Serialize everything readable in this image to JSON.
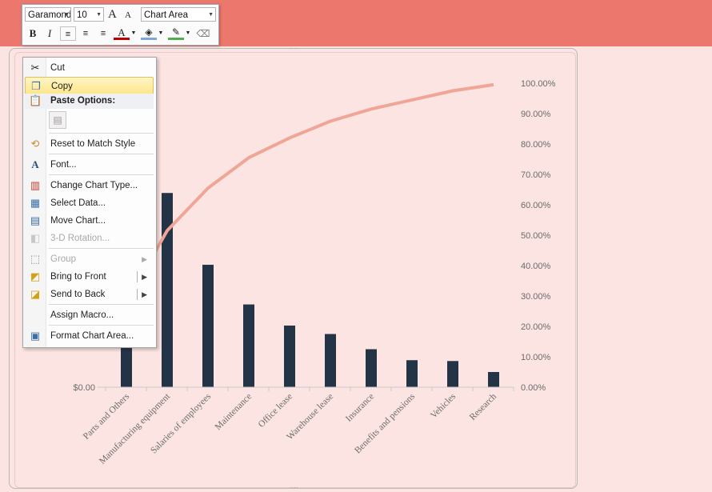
{
  "mini_toolbar": {
    "font_name": "Garamond",
    "font_size": "10",
    "element_selector": "Chart Area",
    "bold": "B",
    "italic": "I",
    "font_color_glyph": "A",
    "grow_font": "A",
    "shrink_font": "A"
  },
  "context_menu": {
    "items": [
      {
        "label": "Cut",
        "icon": "scissors-icon"
      },
      {
        "label": "Copy",
        "icon": "copy-icon"
      },
      {
        "label": "Paste Options:",
        "icon": "paste-icon"
      },
      {
        "label": "Reset to Match Style",
        "icon": "reset-style-icon"
      },
      {
        "label": "Font...",
        "icon": "font-icon"
      },
      {
        "label": "Change Chart Type...",
        "icon": "chart-type-icon"
      },
      {
        "label": "Select Data...",
        "icon": "select-data-icon"
      },
      {
        "label": "Move Chart...",
        "icon": "move-chart-icon"
      },
      {
        "label": "3-D Rotation...",
        "icon": "rotation-3d-icon"
      },
      {
        "label": "Group",
        "icon": "group-icon"
      },
      {
        "label": "Bring to Front",
        "icon": "bring-front-icon"
      },
      {
        "label": "Send to Back",
        "icon": "send-back-icon"
      },
      {
        "label": "Assign Macro...",
        "icon": ""
      },
      {
        "label": "Format Chart Area...",
        "icon": "format-chart-area-icon"
      }
    ]
  },
  "chart_data": {
    "type": "bar",
    "categories": [
      "Parts and Others",
      "Manufacturing equipment",
      "Salaries of employees",
      "Maintenance",
      "Office lease",
      "Warehouse lease",
      "Insurance",
      "Benefits and pensions",
      "Vehicles",
      "Research"
    ],
    "series": [
      {
        "values": [
          0.55,
          2.3,
          1.45,
          0.98,
          0.73,
          0.63,
          0.45,
          0.32,
          0.31,
          0.18
        ],
        "color": "#243447"
      },
      {
        "values": [
          0.28,
          0.515,
          0.655,
          0.755,
          0.82,
          0.875,
          0.915,
          0.945,
          0.975,
          0.995
        ],
        "color": "#f0a697",
        "axis": "secondary"
      }
    ],
    "ylim": [
      0,
      3.6
    ],
    "y2lim": [
      0,
      1.0
    ],
    "y2_ticks": [
      "0.00%",
      "10.00%",
      "20.00%",
      "30.00%",
      "40.00%",
      "50.00%",
      "60.00%",
      "70.00%",
      "80.00%",
      "90.00%",
      "100.00%"
    ],
    "y_ticks_visible": [
      "$0.00"
    ],
    "grid": false
  }
}
